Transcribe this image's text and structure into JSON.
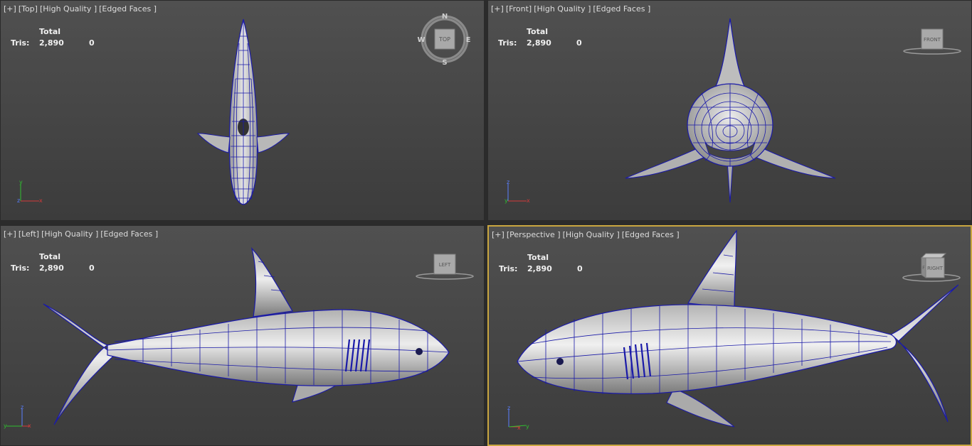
{
  "viewports": [
    {
      "id": "top",
      "label_parts": [
        "[+]",
        "[Top]",
        "[High Quality ]",
        "[Edged Faces ]"
      ],
      "stats": {
        "header": "Total",
        "label": "Tris:",
        "total": "2,890",
        "selected": "0"
      },
      "navcube": {
        "face": "TOP",
        "compass": [
          "N",
          "E",
          "S",
          "W"
        ]
      },
      "axes": [
        "y",
        "z",
        "x"
      ]
    },
    {
      "id": "front",
      "label_parts": [
        "[+]",
        "[Front]",
        "[High Quality ]",
        "[Edged Faces ]"
      ],
      "stats": {
        "header": "Total",
        "label": "Tris:",
        "total": "2,890",
        "selected": "0"
      },
      "navcube": {
        "face": "FRONT"
      },
      "axes": [
        "z",
        "y",
        "x"
      ]
    },
    {
      "id": "left",
      "label_parts": [
        "[+]",
        "[Left]",
        "[High Quality ]",
        "[Edged Faces ]"
      ],
      "stats": {
        "header": "Total",
        "label": "Tris:",
        "total": "2,890",
        "selected": "0"
      },
      "navcube": {
        "face": "LEFT"
      },
      "axes": [
        "z",
        "y",
        "x"
      ]
    },
    {
      "id": "perspective",
      "label_parts": [
        "[+]",
        "[Perspective ]",
        "[High Quality ]",
        "[Edged Faces ]"
      ],
      "stats": {
        "header": "Total",
        "label": "Tris:",
        "total": "2,890",
        "selected": "0"
      },
      "navcube": {
        "face": "RIGHT",
        "side": "F"
      },
      "axes": [
        "z",
        "x",
        "y"
      ]
    }
  ],
  "colors": {
    "wire": "#1a1aa8",
    "active_border": "#c9a640",
    "surface": "#d4d4d4"
  }
}
